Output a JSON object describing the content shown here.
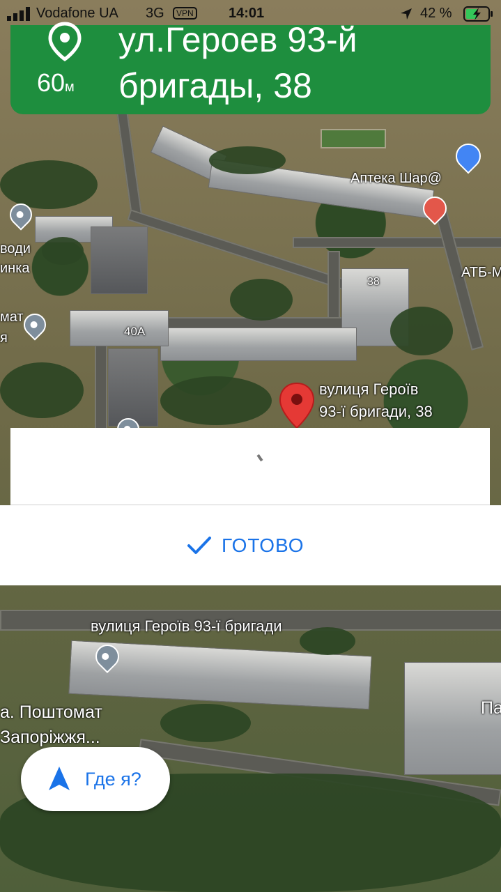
{
  "status_bar": {
    "carrier": "Vodafone UA",
    "network": "3G",
    "vpn": "VPN",
    "time": "14:01",
    "battery": "42 %"
  },
  "nav_banner": {
    "distance_value": "60",
    "distance_unit": "м",
    "street": "ул.Героев 93-й бригады, 38"
  },
  "map_labels": {
    "apteka": "Аптека Шар@",
    "atb": "АТБ-М",
    "vody": "води",
    "lynka": "инка",
    "mat": "мат",
    "ya": "я",
    "house_38": "38",
    "house_40a": "40А",
    "destination_line1": "вулиця Героїв",
    "destination_line2": "93-ї бригади, 38",
    "street_lower": "вулиця Героїв 93-ї бригади",
    "poshtomat_line1": "а. Поштомат",
    "poshtomat_line2": "Запоріжжя...",
    "right_edge": "Па"
  },
  "ready_button": {
    "label": "ГОТОВО"
  },
  "where_am_i": {
    "label": "Где я?"
  },
  "colors": {
    "banner_green": "#1e8e3e",
    "accent_blue": "#1a73e8",
    "destination_red": "#e53935"
  }
}
